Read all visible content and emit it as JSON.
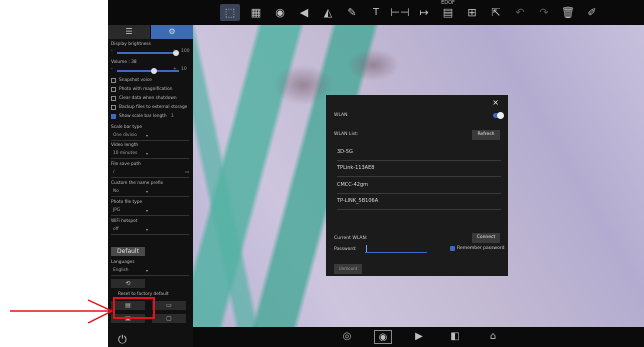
{
  "toolbar": {
    "text_tool_label": "T",
    "edof_label": "EDOF"
  },
  "sidebar": {
    "tabs": [
      {
        "name": "adjust",
        "icon": "sliders-icon"
      },
      {
        "name": "settings",
        "icon": "gear-icon"
      }
    ],
    "display_brightness": {
      "label": "Display brightness",
      "min": "-",
      "max": "+",
      "value": "100"
    },
    "volume": {
      "label": "Volume : 38",
      "min": "-",
      "max": "+",
      "value": "10"
    },
    "checkboxes": [
      {
        "label": "Snapshot voice",
        "checked": false
      },
      {
        "label": "Photo with magnification",
        "checked": false
      },
      {
        "label": "Clear data when shutdown",
        "checked": false
      },
      {
        "label": "Backup files to external storage",
        "checked": false
      },
      {
        "label": "Show scale bar length",
        "checked": true,
        "value": "1"
      }
    ],
    "scale_bar_type": {
      "label": "Scale bar type",
      "value": "One divisio"
    },
    "video_length": {
      "label": "Video length",
      "value": "10 minutes"
    },
    "file_save_path": {
      "label": "File save path",
      "value": "/"
    },
    "custom_name_prefix": {
      "label": "Custom the name prefix",
      "value": "No"
    },
    "photo_file_type": {
      "label": "Photo file type",
      "value": "JPG"
    },
    "wifi_hotspot": {
      "label": "WiFi hotspot",
      "value": "off"
    },
    "default_button": "Default",
    "languages": {
      "label": "Languages",
      "value": "English"
    },
    "reset_label": "Reset to factory default"
  },
  "wlan_dialog": {
    "close_label": "×",
    "wlan_label": "WLAN",
    "wlan_on": true,
    "list_label": "WLAN List:",
    "refresh_label": "Refresh",
    "networks": [
      "3D-5G",
      "TPLink-113AE8",
      "CMCC-42gm",
      "TP-LINK_5B106A"
    ],
    "current_label": "Current WLAN:",
    "connect_label": "Connect",
    "password_label": "Password:",
    "password_value": "",
    "remember_label": "Remember password",
    "remember_checked": true,
    "unmount_label": "Unmount"
  },
  "colors": {
    "accent": "#3c6ac4",
    "annotation": "#e3121a"
  }
}
